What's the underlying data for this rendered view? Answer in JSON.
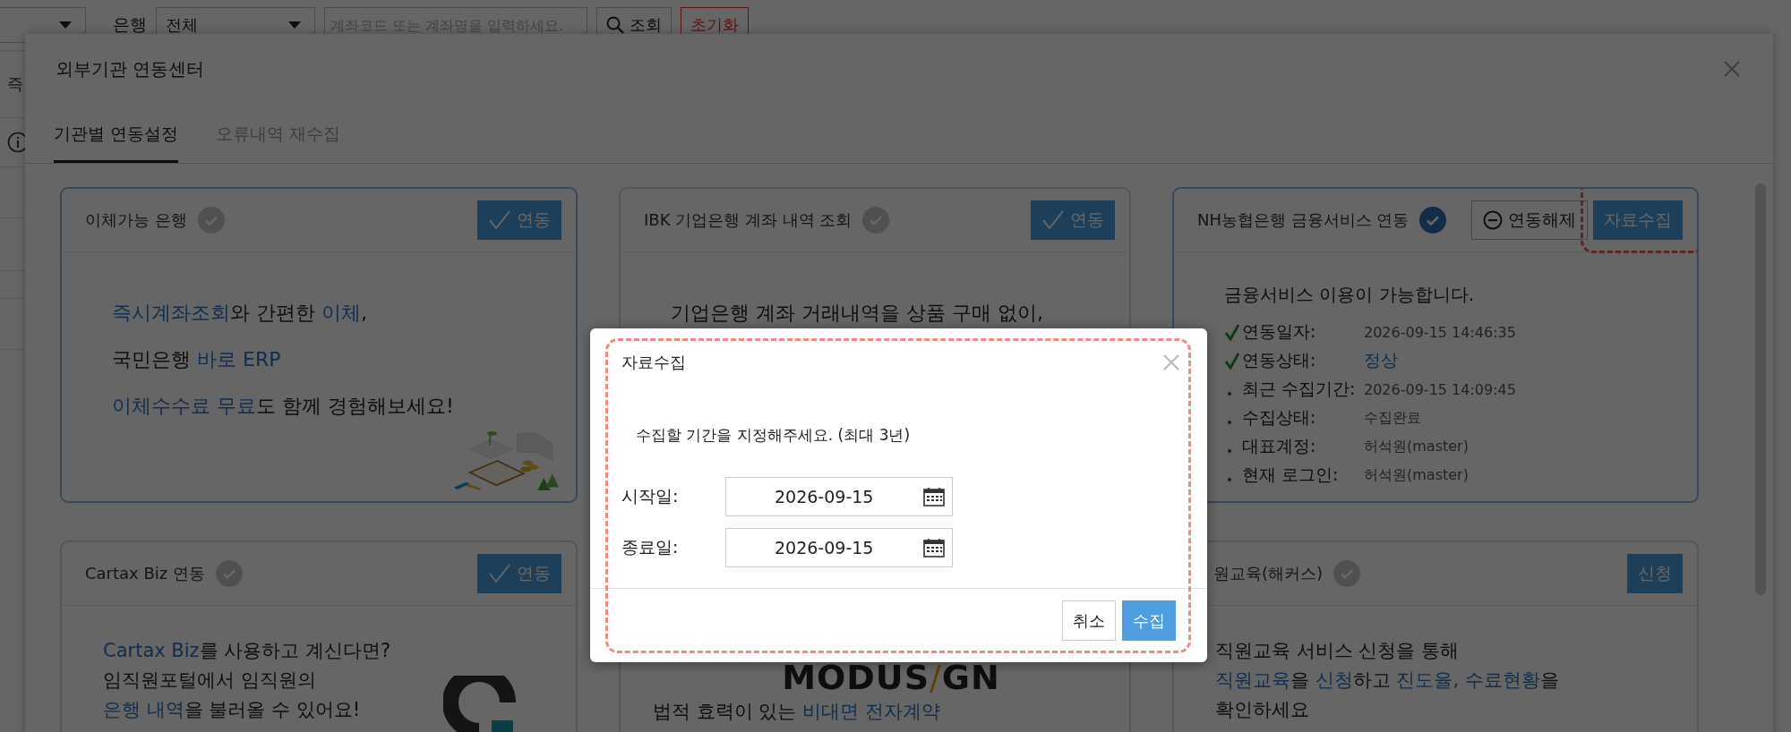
{
  "page": {
    "bank_filter": {
      "label": "은행",
      "value": "전체"
    },
    "search": {
      "placeholder": "계좌코드 또는 계좌명을 입력하세요."
    },
    "search_button": "조회",
    "reset_button": "초기화",
    "table_fragment": "즉"
  },
  "modal": {
    "title": "외부기관 연동센터",
    "tabs": [
      {
        "label": "기관별 연동설정",
        "selected": true
      },
      {
        "label": "오류내역 재수집",
        "selected": false
      }
    ],
    "cards": [
      {
        "title": "이체가능 은행",
        "selected": true,
        "linked": false,
        "actions": [
          {
            "kind": "link",
            "label": "연동"
          }
        ],
        "body": {
          "kind": "promo",
          "lines": [
            "**즉시계좌조회**와 간편한 **이체**,",
            "국민은행 **바로 ERP**",
            "**이체수수료 무료**도 함께 경험해보세요!"
          ]
        }
      },
      {
        "title": "IBK 기업은행 계좌 내역 조회",
        "selected": false,
        "linked": false,
        "actions": [
          {
            "kind": "link",
            "label": "연동"
          }
        ],
        "body": {
          "kind": "promo",
          "lines": [
            "기업은행 계좌 거래내역을 상품 구매 없이,"
          ]
        }
      },
      {
        "title": "NH농협은행 금융서비스 연동",
        "selected": true,
        "linked": true,
        "actions": [
          {
            "kind": "unlink",
            "label": "연동해제"
          },
          {
            "kind": "collect",
            "label": "자료수집",
            "highlighted": true
          }
        ],
        "body": {
          "kind": "status",
          "heading": "금융서비스 이용이 가능합니다.",
          "rows": [
            {
              "kind": "check",
              "label": "연동일자:",
              "value": "2026-09-15 14:46:35",
              "emphasis": false
            },
            {
              "kind": "check",
              "label": "연동상태:",
              "value": "정상",
              "emphasis": true
            },
            {
              "kind": "dot",
              "label": "최근 수집기간:",
              "value": "2026-09-15 14:09:45",
              "emphasis": false
            },
            {
              "kind": "dot",
              "label": "수집상태:",
              "value": "수집완료",
              "emphasis": false
            },
            {
              "kind": "dot",
              "label": "대표계정:",
              "value": "허석원(master)",
              "emphasis": false
            },
            {
              "kind": "dot",
              "label": "현재 로그인:",
              "value": "허석원(master)",
              "emphasis": false
            }
          ]
        }
      },
      {
        "title": "Cartax Biz 연동",
        "selected": false,
        "linked": false,
        "actions": [
          {
            "kind": "link",
            "label": "연동"
          }
        ],
        "body": {
          "kind": "promo",
          "lines": [
            "**Cartax Biz**를 사용하고 계신다면?",
            "임직원포털에서 임직원의",
            "**은행 내역**을 불러올 수 있어요!"
          ]
        }
      },
      {
        "selected": false,
        "body": {
          "kind": "promo",
          "logo": "MODUS**/**GN",
          "lines": [
            "법적 효력이 있는 **비대면 전자계약**"
          ]
        }
      },
      {
        "title": "원교육(해커스)",
        "selected": false,
        "linked": false,
        "actions": [
          {
            "kind": "apply",
            "label": "신청"
          }
        ],
        "body": {
          "kind": "promo",
          "lines": [
            "직원교육 서비스 신청을 통해",
            "**직원교육**을 **신청**하고 **진도율, 수료현황**을",
            "확인하세요"
          ]
        }
      }
    ]
  },
  "dialog": {
    "title": "자료수집",
    "highlighted": true,
    "message": "수집할 기간을 지정해주세요. (최대 3년)",
    "fields": [
      {
        "label": "시작일:",
        "value": "2026-09-15"
      },
      {
        "label": "종료일:",
        "value": "2026-09-15"
      }
    ],
    "buttons": [
      {
        "kind": "secondary",
        "label": "취소"
      },
      {
        "kind": "primary",
        "label": "수집"
      }
    ]
  }
}
